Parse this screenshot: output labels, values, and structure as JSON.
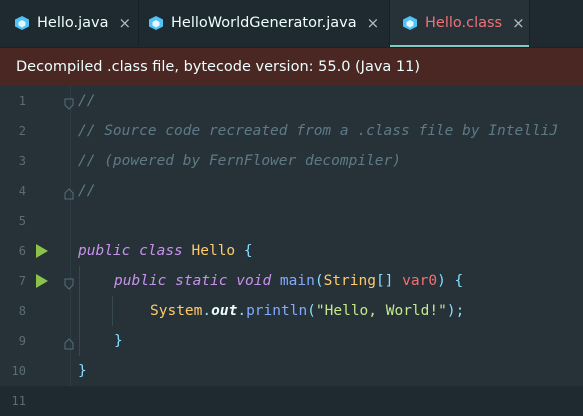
{
  "tabs": [
    {
      "label": "Hello.java",
      "icon": "java-file-icon",
      "active": false
    },
    {
      "label": "HelloWorldGenerator.java",
      "icon": "java-file-icon",
      "active": false
    },
    {
      "label": "Hello.class",
      "icon": "class-file-icon",
      "active": true
    }
  ],
  "close_glyph": "×",
  "banner": "Decompiled .class file, bytecode version: 55.0 (Java 11)",
  "line_numbers": [
    "1",
    "2",
    "3",
    "4",
    "5",
    "6",
    "7",
    "8",
    "9",
    "10",
    "11"
  ],
  "code": {
    "l1": "//",
    "l2": "// Source code recreated from a .class file by IntelliJ",
    "l3": "// (powered by FernFlower decompiler)",
    "l4": "//",
    "l6_kw1": "public",
    "l6_kw2": "class",
    "l6_name": "Hello",
    "l6_brace": "{",
    "l7_kw1": "public",
    "l7_kw2": "static",
    "l7_kw3": "void",
    "l7_fn": "main",
    "l7_open": "(",
    "l7_type": "String",
    "l7_arr": "[]",
    "l7_param": "var0",
    "l7_close": ")",
    "l7_brace": "{",
    "l8_cls": "System",
    "l8_dot1": ".",
    "l8_field": "out",
    "l8_dot2": ".",
    "l8_fn": "println",
    "l8_open": "(",
    "l8_str": "\"Hello, World!\"",
    "l8_close": ")",
    "l8_semi": ";",
    "l9": "}",
    "l10": "}"
  },
  "colors": {
    "background": "#263238",
    "banner": "#4a2723",
    "accent": "#80cbc4",
    "run_icon": "#8bc34a"
  }
}
